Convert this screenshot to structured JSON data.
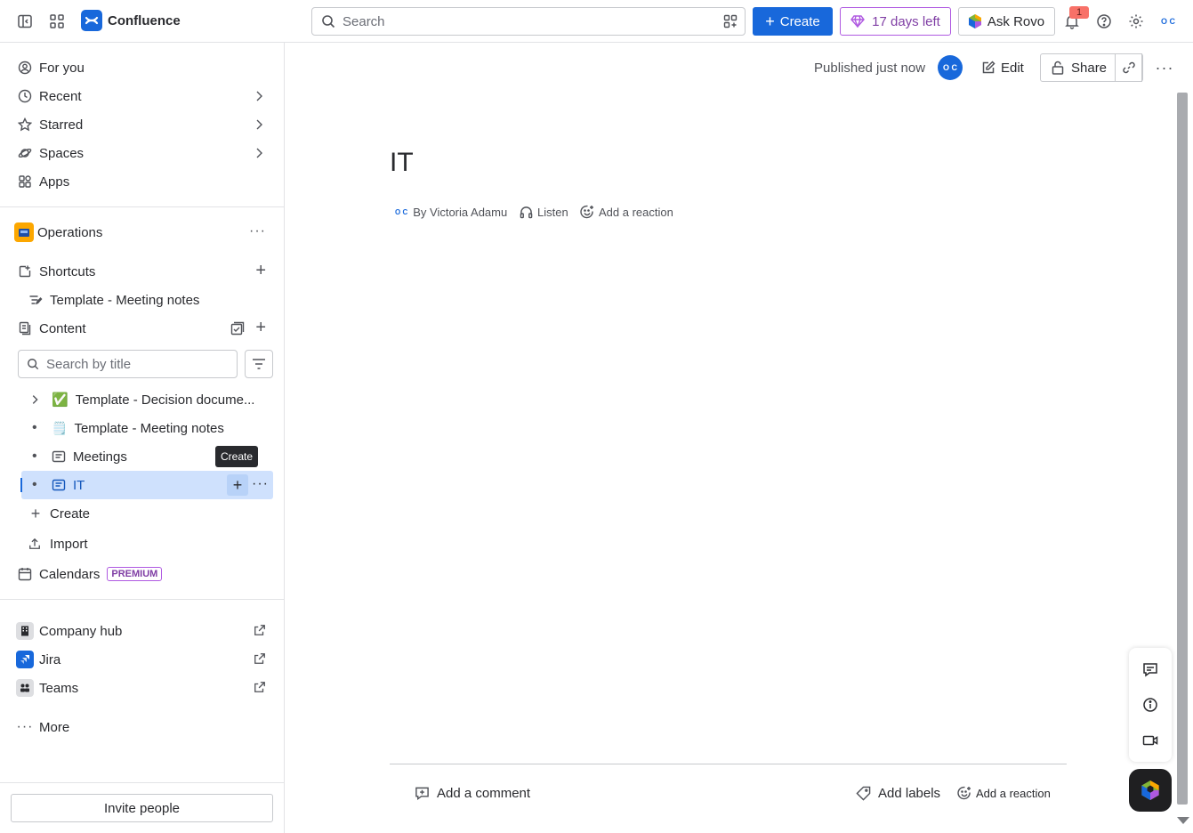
{
  "topbar": {
    "app_name": "Confluence",
    "search_placeholder": "Search",
    "create_label": "Create",
    "trial_label": "17 days left",
    "rovo_label": "Ask Rovo",
    "notification_count": "1",
    "profile_initials": "O C"
  },
  "sidebar": {
    "nav": [
      {
        "label": "For you",
        "icon": "person-circle-icon"
      },
      {
        "label": "Recent",
        "icon": "clock-icon"
      },
      {
        "label": "Starred",
        "icon": "star-icon"
      },
      {
        "label": "Spaces",
        "icon": "planet-icon"
      },
      {
        "label": "Apps",
        "icon": "apps-icon"
      }
    ],
    "space_name": "Operations",
    "shortcuts_label": "Shortcuts",
    "shortcut_item": "Template - Meeting notes",
    "content_label": "Content",
    "search_title_placeholder": "Search by title",
    "tree": [
      {
        "label": "Template - Decision docume...",
        "emoji": "✅"
      },
      {
        "label": "Template - Meeting notes",
        "emoji": "🗒️"
      },
      {
        "label": "Meetings"
      },
      {
        "label": "IT"
      }
    ],
    "tooltip": "Create",
    "create_label": "Create",
    "import_label": "Import",
    "calendars_label": "Calendars",
    "premium_badge": "PREMIUM",
    "external": [
      {
        "label": "Company hub"
      },
      {
        "label": "Jira"
      },
      {
        "label": "Teams"
      }
    ],
    "more_label": "More",
    "invite_label": "Invite people"
  },
  "page": {
    "published": "Published just now",
    "avatar_initials": "O C",
    "edit_label": "Edit",
    "share_label": "Share",
    "title": "IT",
    "byline": "By Victoria Adamu",
    "listen_label": "Listen",
    "reaction_label": "Add a reaction",
    "comment_label": "Add a comment",
    "labels_label": "Add labels",
    "footer_reaction_label": "Add a reaction"
  },
  "colors": {
    "brand": "#1868db",
    "trial": "#803fa5",
    "selected": "#cfe1fd"
  }
}
